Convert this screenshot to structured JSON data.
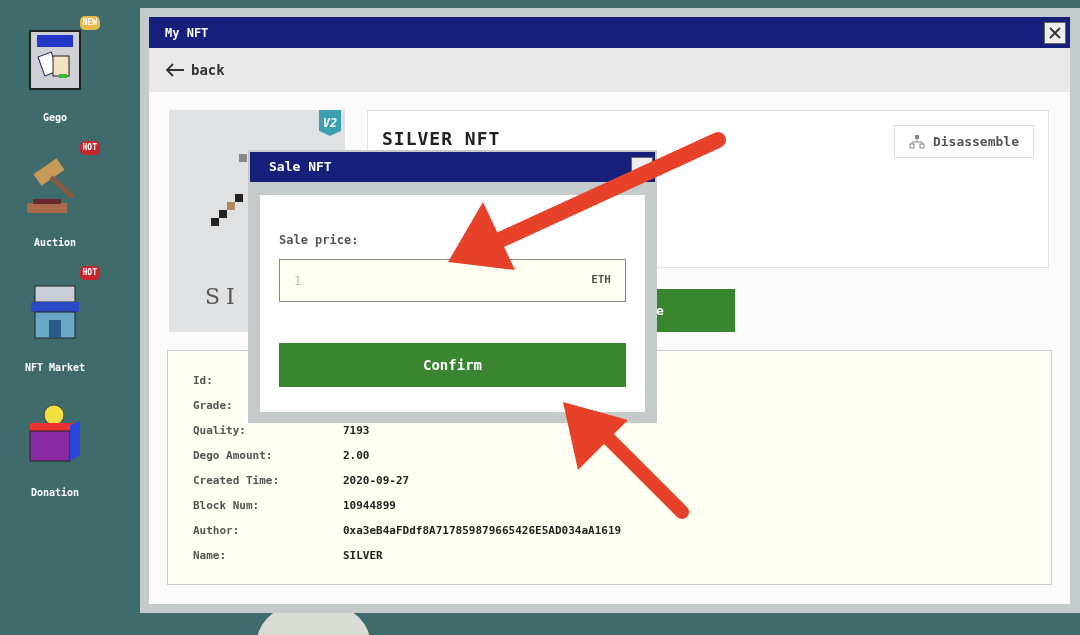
{
  "desktop": {
    "icons": [
      {
        "kind": "nft",
        "label": "Gego",
        "badge": {
          "text": "NEW",
          "color": "#e6b94a"
        }
      },
      {
        "kind": "gavel",
        "label": "Auction",
        "badge": {
          "text": "HOT",
          "color": "#c8262e"
        }
      },
      {
        "kind": "market",
        "label": "NFT Market",
        "badge": {
          "text": "HOT",
          "color": "#c8262e"
        }
      },
      {
        "kind": "donation",
        "label": "Donation"
      }
    ]
  },
  "window": {
    "title": "My NFT",
    "back": "back",
    "card": {
      "version": "V2",
      "name_visible": "SI"
    },
    "info": {
      "title": "SILVER NFT",
      "disassemble": "Disassemble",
      "action_visible": "e"
    },
    "details": [
      {
        "label": "Id:"
      },
      {
        "label": "Grade:"
      },
      {
        "label": "Quality:",
        "value": "7193"
      },
      {
        "label": "Dego Amount:",
        "value": "2.00"
      },
      {
        "label": "Created Time:",
        "value": "2020-09-27"
      },
      {
        "label": "Block Num:",
        "value": "10944899"
      },
      {
        "label": "Author:",
        "value": "0xa3eB4aFDdf8A717859879665426E5AD034aA1619"
      },
      {
        "label": "Name:",
        "value": "SILVER"
      }
    ]
  },
  "dialog": {
    "title": "Sale NFT",
    "field_label": "Sale price:",
    "placeholder": "1",
    "unit": "ETH",
    "confirm": "Confirm"
  }
}
